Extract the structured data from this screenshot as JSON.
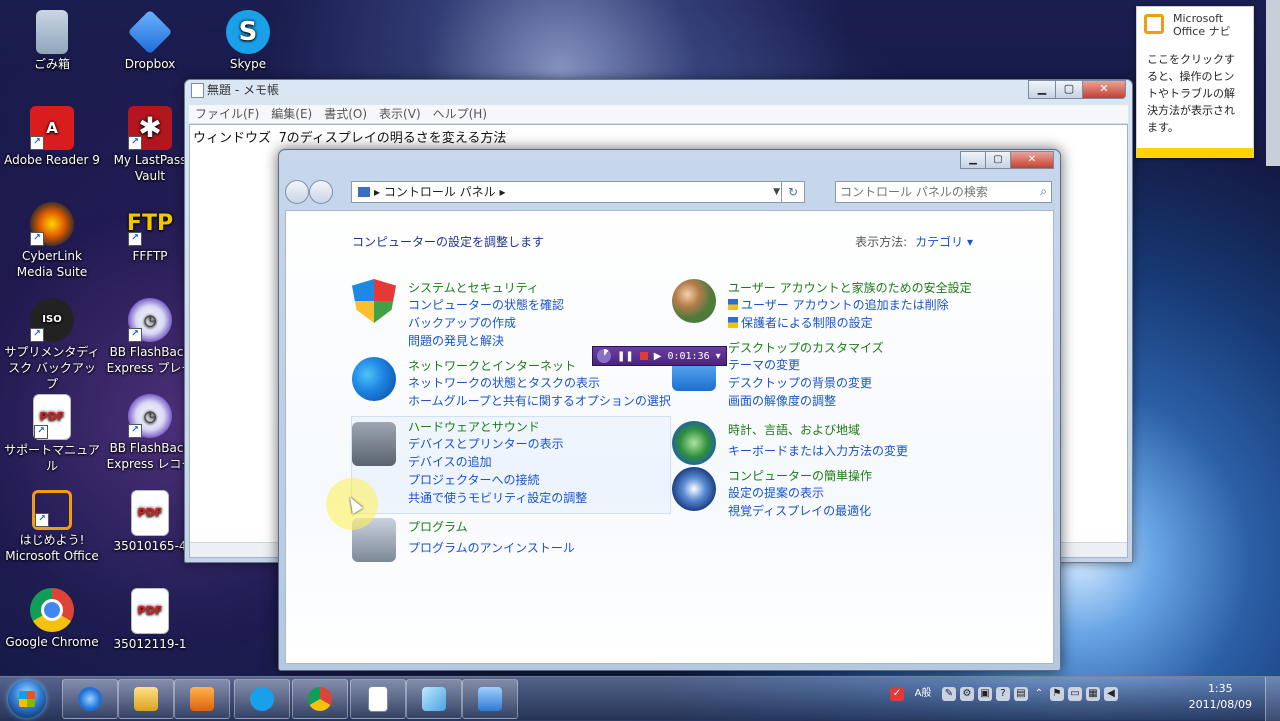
{
  "desktop": {
    "icons": [
      {
        "label": "ごみ箱",
        "icon": "recycle-bin-icon"
      },
      {
        "label": "Dropbox",
        "icon": "dropbox-icon"
      },
      {
        "label": "Skype",
        "icon": "skype-icon"
      },
      {
        "label": "Adobe Reader 9",
        "icon": "adobe-reader-icon"
      },
      {
        "label": "My LastPass Vault",
        "icon": "lastpass-icon"
      },
      {
        "label": "CyberLink Media Suite",
        "icon": "cyberlink-icon"
      },
      {
        "label": "FFFTP",
        "icon": "ffftp-icon"
      },
      {
        "label": "サプリメンタディスク バックアップ",
        "icon": "iso-disc-icon"
      },
      {
        "label": "BB FlashBack Express プレー",
        "icon": "flashback-player-icon"
      },
      {
        "label": "サポートマニュアル",
        "icon": "pdf-icon"
      },
      {
        "label": "BB FlashBack Express レコー",
        "icon": "flashback-recorder-icon"
      },
      {
        "label": "はじめよう! Microsoft Office",
        "icon": "office-icon"
      },
      {
        "label": "35010165-4",
        "icon": "pdf-icon"
      },
      {
        "label": "Google Chrome",
        "icon": "chrome-icon"
      },
      {
        "label": "35012119-1",
        "icon": "pdf-icon"
      }
    ]
  },
  "notepad": {
    "title": "無題 - メモ帳",
    "menu": [
      "ファイル(F)",
      "編集(E)",
      "書式(O)",
      "表示(V)",
      "ヘルプ(H)"
    ],
    "content": "ウィンドウズ 7のディスプレイの明るさを変える方法"
  },
  "control_panel": {
    "address": "コントロール パネル",
    "search_placeholder": "コントロール パネルの検索",
    "heading": "コンピューターの設定を調整します",
    "view_by_label": "表示方法:",
    "view_by_value": "カテゴリ",
    "left": [
      {
        "title": "システムとセキュリティ",
        "links": [
          "コンピューターの状態を確認",
          "バックアップの作成",
          "問題の発見と解決"
        ]
      },
      {
        "title": "ネットワークとインターネット",
        "links": [
          "ネットワークの状態とタスクの表示",
          "ホームグループと共有に関するオプションの選択"
        ]
      },
      {
        "title": "ハードウェアとサウンド",
        "links": [
          "デバイスとプリンターの表示",
          "デバイスの追加",
          "プロジェクターへの接続",
          "共通で使うモビリティ設定の調整"
        ]
      },
      {
        "title": "プログラム",
        "links": [
          "プログラムのアンインストール"
        ]
      }
    ],
    "right": [
      {
        "title": "ユーザー アカウントと家族のための安全設定",
        "links": [
          "ユーザー アカウントの追加または削除",
          "保護者による制限の設定"
        ]
      },
      {
        "title": "デスクトップのカスタマイズ",
        "links": [
          "テーマの変更",
          "デスクトップの背景の変更",
          "画面の解像度の調整"
        ]
      },
      {
        "title": "時計、言語、および地域",
        "links": [
          "キーボードまたは入力方法の変更"
        ]
      },
      {
        "title": "コンピューターの簡単操作",
        "links": [
          "設定の提案の表示",
          "視覚ディスプレイの最適化"
        ]
      }
    ]
  },
  "recorder": {
    "time": "0:01:36"
  },
  "office_navi": {
    "title_line1": "Microsoft",
    "title_line2": "Office ナビ",
    "body": "ここをクリックすると、操作のヒントやトラブルの解決方法が表示されます。"
  },
  "taskbar": {
    "pinned": [
      "ie-icon",
      "explorer-icon",
      "media-player-icon",
      "skype-icon",
      "chrome-icon",
      "notepad-icon",
      "aero-window-icon",
      "control-panel-icon"
    ],
    "ime": "A般",
    "time": "1:35",
    "date": "2011/08/09"
  }
}
